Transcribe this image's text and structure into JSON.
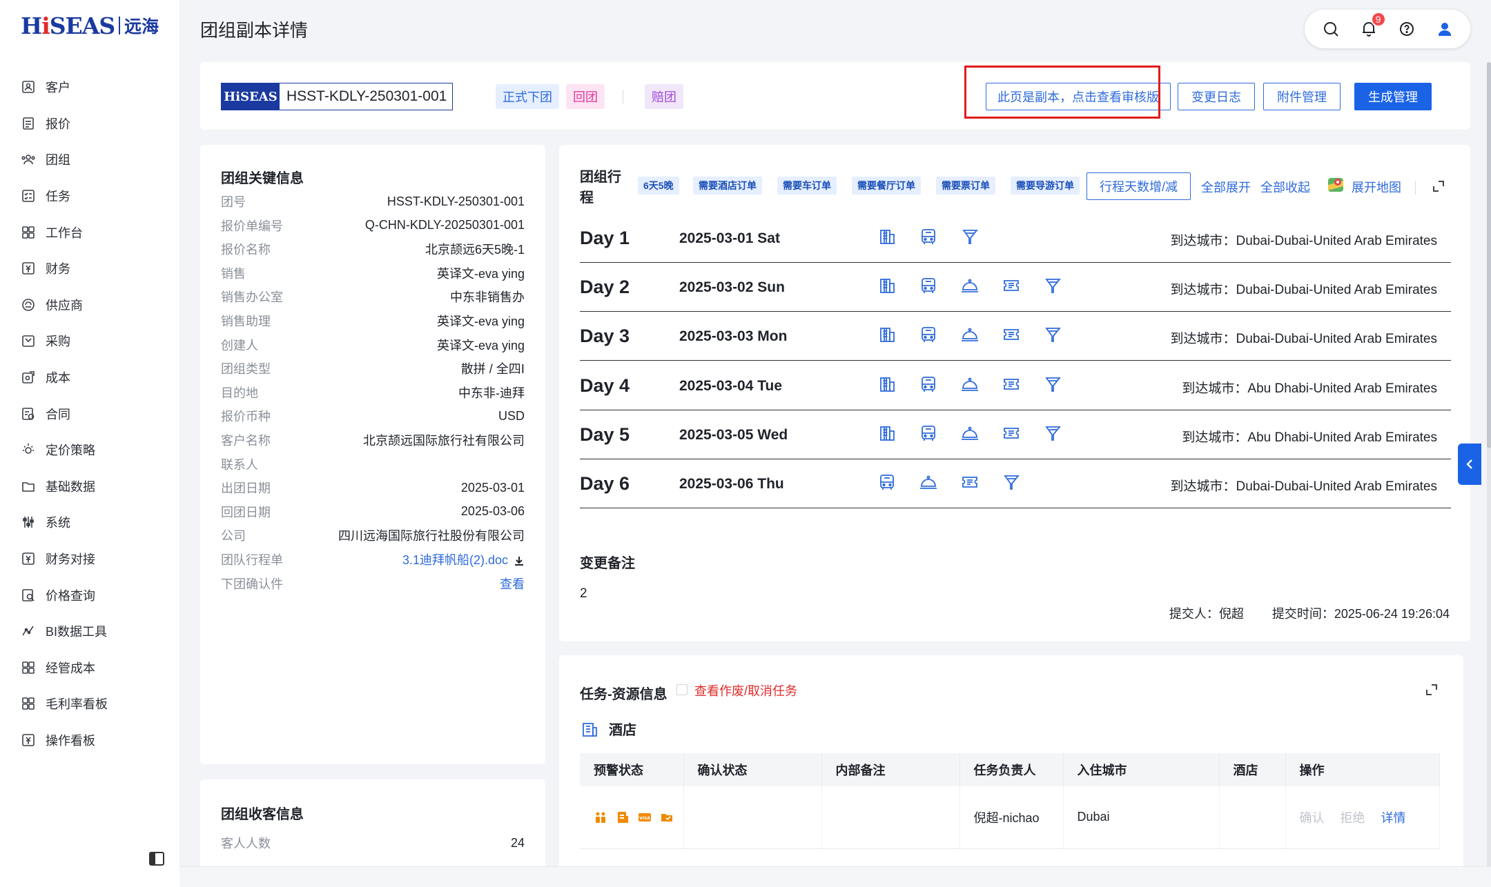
{
  "brand": {
    "logo_text": "HiSEAS",
    "logo_cn": "远海"
  },
  "sidebar": {
    "items": [
      {
        "label": "客户",
        "icon": "customer-icon"
      },
      {
        "label": "报价",
        "icon": "quote-icon"
      },
      {
        "label": "团组",
        "icon": "group-icon"
      },
      {
        "label": "任务",
        "icon": "task-icon"
      },
      {
        "label": "工作台",
        "icon": "workbench-icon"
      },
      {
        "label": "财务",
        "icon": "finance-icon"
      },
      {
        "label": "供应商",
        "icon": "supplier-icon"
      },
      {
        "label": "采购",
        "icon": "purchase-icon"
      },
      {
        "label": "成本",
        "icon": "cost-icon"
      },
      {
        "label": "合同",
        "icon": "contract-icon"
      },
      {
        "label": "定价策略",
        "icon": "pricing-icon"
      },
      {
        "label": "基础数据",
        "icon": "base-data-icon"
      },
      {
        "label": "系统",
        "icon": "system-icon"
      },
      {
        "label": "财务对接",
        "icon": "finance-link-icon"
      },
      {
        "label": "价格查询",
        "icon": "price-query-icon"
      },
      {
        "label": "BI数据工具",
        "icon": "bi-icon"
      },
      {
        "label": "经管成本",
        "icon": "mgmt-cost-icon"
      },
      {
        "label": "毛利率看板",
        "icon": "margin-board-icon"
      },
      {
        "label": "操作看板",
        "icon": "ops-board-icon"
      }
    ]
  },
  "header": {
    "title": "团组副本详情",
    "notification_count": "9"
  },
  "topbar": {
    "code_logo": "HiSEAS",
    "group_code": "HSST-KDLY-250301-001",
    "tags": [
      "正式下团",
      "回团",
      "赔团"
    ],
    "buttons": {
      "copy_notice": "此页是副本，点击查看审核版",
      "change_log": "变更日志",
      "attachments": "附件管理",
      "generate": "生成管理"
    }
  },
  "key_info": {
    "title": "团组关键信息",
    "rows": [
      {
        "k": "团号",
        "v": "HSST-KDLY-250301-001"
      },
      {
        "k": "报价单编号",
        "v": "Q-CHN-KDLY-20250301-001"
      },
      {
        "k": "报价名称",
        "v": "北京颉远6天5晚-1"
      },
      {
        "k": "销售",
        "v": "英译文-eva ying"
      },
      {
        "k": "销售办公室",
        "v": "中东非销售办"
      },
      {
        "k": "销售助理",
        "v": "英译文-eva ying"
      },
      {
        "k": "创建人",
        "v": "英译文-eva ying"
      },
      {
        "k": "团组类型",
        "v": "散拼 / 全四Ⅰ"
      },
      {
        "k": "目的地",
        "v": "中东非-迪拜"
      },
      {
        "k": "报价币种",
        "v": "USD"
      },
      {
        "k": "客户名称",
        "v": "北京颉远国际旅行社有限公司"
      },
      {
        "k": "联系人",
        "v": ""
      },
      {
        "k": "出团日期",
        "v": "2025-03-01"
      },
      {
        "k": "回团日期",
        "v": "2025-03-06"
      },
      {
        "k": "公司",
        "v": "四川远海国际旅行社股份有限公司"
      },
      {
        "k": "团队行程单",
        "v": "3.1迪拜帆船(2).doc"
      },
      {
        "k": "下团确认件",
        "v": "查看"
      }
    ]
  },
  "guest_info": {
    "title": "团组收客信息",
    "rows": [
      {
        "k": "客人人数",
        "v": "24"
      }
    ]
  },
  "itinerary": {
    "title": "团组行程",
    "tags": [
      "6天5晚",
      "需要酒店订单",
      "需要车订单",
      "需要餐厅订单",
      "需要票订单",
      "需要导游订单"
    ],
    "adjust_button": "行程天数增/减",
    "expand_all": "全部展开",
    "collapse_all": "全部收起",
    "open_map": "展开地图",
    "city_prefix": "到达城市：",
    "days": [
      {
        "label": "Day 1",
        "date": "2025-03-01 Sat",
        "icons": [
          "hotel",
          "bus",
          "guide"
        ],
        "city": "Dubai-Dubai-United Arab Emirates"
      },
      {
        "label": "Day 2",
        "date": "2025-03-02 Sun",
        "icons": [
          "hotel",
          "bus",
          "meal",
          "ticket",
          "guide"
        ],
        "city": "Dubai-Dubai-United Arab Emirates"
      },
      {
        "label": "Day 3",
        "date": "2025-03-03 Mon",
        "icons": [
          "hotel",
          "bus",
          "meal",
          "ticket",
          "guide"
        ],
        "city": "Dubai-Dubai-United Arab Emirates"
      },
      {
        "label": "Day 4",
        "date": "2025-03-04 Tue",
        "icons": [
          "hotel",
          "bus",
          "meal",
          "ticket",
          "guide"
        ],
        "city": "Abu Dhabi-United Arab Emirates"
      },
      {
        "label": "Day 5",
        "date": "2025-03-05 Wed",
        "icons": [
          "hotel",
          "bus",
          "meal",
          "ticket",
          "guide"
        ],
        "city": "Abu Dhabi-United Arab Emirates"
      },
      {
        "label": "Day 6",
        "date": "2025-03-06 Thu",
        "icons": [
          "bus",
          "meal",
          "ticket",
          "guide"
        ],
        "city": "Dubai-Dubai-United Arab Emirates"
      }
    ],
    "remark": {
      "title": "变更备注",
      "value": "2",
      "submitter_label": "提交人：",
      "submitter": "倪超",
      "time_label": "提交时间：",
      "time": "2025-06-24 19:26:04"
    }
  },
  "tasks": {
    "title": "任务-资源信息",
    "void_link": "查看作废/取消任务",
    "hotel_title": "酒店",
    "columns": [
      "预警状态",
      "确认状态",
      "内部备注",
      "任务负责人",
      "入住城市",
      "酒店",
      "操作"
    ],
    "rows": [
      {
        "confirm": "",
        "note": "",
        "owner": "倪超-nichao",
        "city": "Dubai",
        "hotel": "",
        "ops": [
          "确认",
          "拒绝",
          "详情"
        ]
      }
    ]
  },
  "colors": {
    "primary": "#1a63e6",
    "brand": "#1a3aa0",
    "highlight": "#e11b1b",
    "warn": "#f08a00"
  }
}
